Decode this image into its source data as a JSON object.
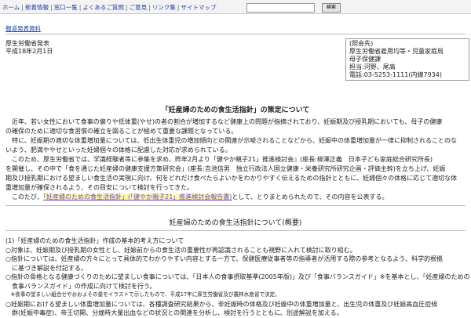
{
  "nav": {
    "items": [
      "ホーム",
      "新着情報",
      "窓口一覧",
      "よくあるご質問",
      "ご意見",
      "リンク集",
      "サイトマップ"
    ],
    "search_placeholder": "",
    "search_button": "検索"
  },
  "sublink": "報道発表資料",
  "pub": {
    "org": "厚生労働省発表",
    "date": "平成18年2月1日"
  },
  "contact": {
    "lines": [
      "(照会先)",
      "厚生労働省雇用均等・児童家庭局",
      "母子保健課",
      "担当:河野、尾高",
      "電話:03-5253-1111(内線7934)"
    ]
  },
  "title": "「妊産婦のための食生活指針」の策定について",
  "body": {
    "p1_l1": "　近年、若い女性において食事の偏りや低体重(やせ)の者の割合が増加するなど健康上の問題が指摘されており、妊娠期及び授乳期においても、母子の健康",
    "p1_l2": "の確保のために適切な食習慣の確立を図ることが極めて重要な課題となっている。",
    "p2_l1": "　特に、妊娠期の適切な体重増加量については、低出生体重児の増加傾向との関連が示唆されることなどから、妊娠中の体重増加量が一律に抑制されることのな",
    "p2_l2": "いよう、肥満ややせといった妊婦個々の体格に配慮した対応が求められている。",
    "p3_l1": "　このため、厚生労働省では、学識経験者等に参集を求め、昨年2月より「健やか親子21」推進検討会』(座長:柳澤正義　日本子ども家庭総合研究所長)",
    "p3_l2": "を開催し、その中で「食を通じた妊産婦の健康支援方策研究会」(座長:吉池信男　独立行政法人国立健康・栄養研究所研究企画・評価主幹)を立ち上げ、妊娠",
    "p3_l3": "期及び授乳期における望ましい食生活の実現に向け、何をどれだけ食べたらよいかをわかりやすく伝えるための指針とともに、妊婦個々の体格に応じて適切な体",
    "p3_l4": "重増加量が確保されるよう、その目安について検討を行ってきた。",
    "p4_pre": "　このたび、",
    "p4_link": "「妊産婦のための食生活指針」(「健やか親子21」推進検討会報告書)",
    "p4_post": "として、とりまとめられたので、その内容を公表する。"
  },
  "summary": {
    "title": "妊産婦のための食生活指針について(概要)",
    "heading": "(1)「妊産婦のための食生活指針」作成の基本的考え方について",
    "b1": "○対象は、妊娠期及び授乳期の女性とし、妊娠前からの食生活の重要性が再認識されることも視野に入れて検討に取り組む。",
    "b2_l1": "○指針については、妊産婦の方々にとって具体的でわかりやすい内容とする一方で、保健医療従事者等の指導者が活用する際の参考となるよう、科学的根拠",
    "b2_l2": "　に基づき解説を付記する。",
    "b3_l1": "○指針の骨格となる健康づくりのために望ましい食事については、「日本人の食事摂取基準(2005年版)」及び「食事バランスガイド」※を基本とし、「妊産婦のための",
    "b3_l2": "　食事バランスガイド」の作成に向けて検討を行う。",
    "b3_note": "　※食事の望ましい組合せやおおよその量をイラストで示したもので、平成17年に厚生労働省及び農林水産省で決定。",
    "b4_l1": "○妊娠期における望ましい体重増加量については、各種調査研究結果から、非妊娠時の体格及び妊娠中の体重増加量と、出生児の体重及び妊娠高血圧症候",
    "b4_l2": "　群(妊娠中毒症)、帝王切開、分娩時大量出血などの状況との関連を分析し、検討を行うとともに、別途解説を加える。"
  }
}
